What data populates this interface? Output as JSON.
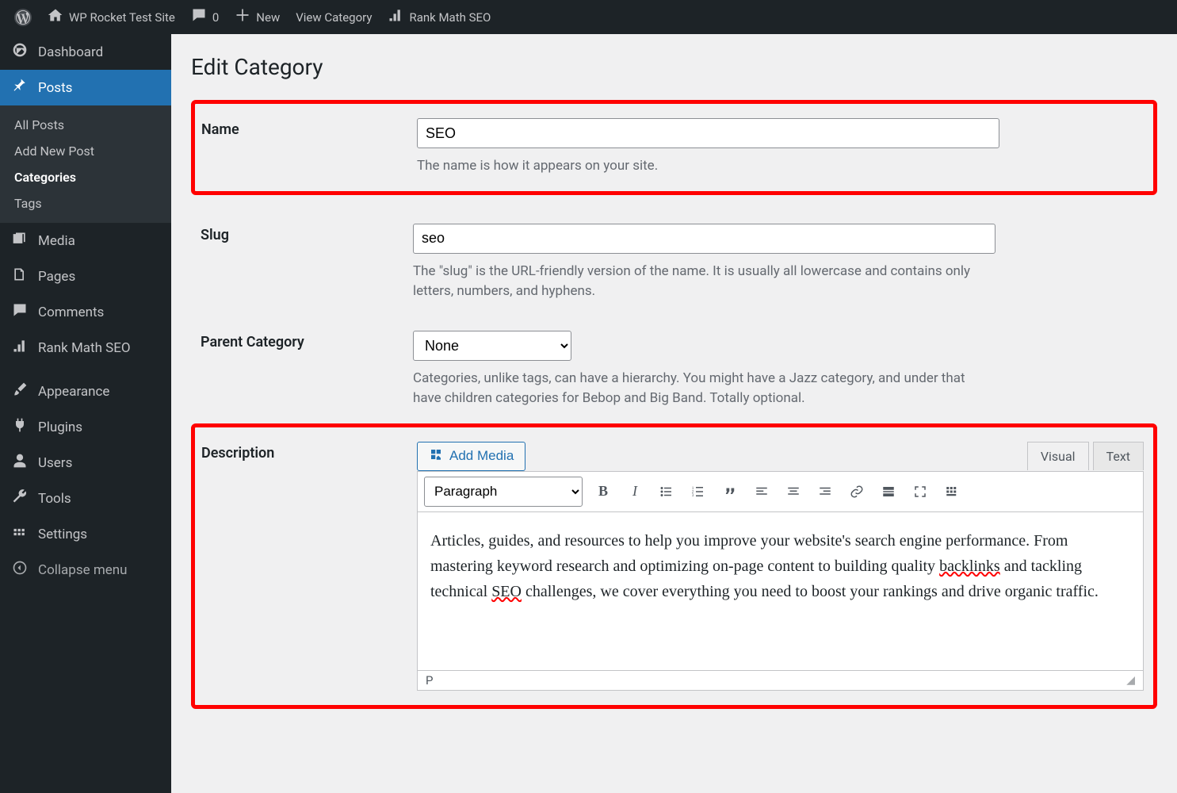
{
  "adminbar": {
    "site_title": "WP Rocket Test Site",
    "comments_count": "0",
    "new_label": "New",
    "view_label": "View Category",
    "rankmath_label": "Rank Math SEO"
  },
  "sidebar": {
    "dashboard": "Dashboard",
    "posts": "Posts",
    "posts_sub": {
      "all": "All Posts",
      "add": "Add New Post",
      "categories": "Categories",
      "tags": "Tags"
    },
    "media": "Media",
    "pages": "Pages",
    "comments": "Comments",
    "rankmath": "Rank Math SEO",
    "appearance": "Appearance",
    "plugins": "Plugins",
    "users": "Users",
    "tools": "Tools",
    "settings": "Settings",
    "collapse": "Collapse menu"
  },
  "page": {
    "title": "Edit Category",
    "name": {
      "label": "Name",
      "value": "SEO",
      "desc": "The name is how it appears on your site."
    },
    "slug": {
      "label": "Slug",
      "value": "seo",
      "desc": "The \"slug\" is the URL-friendly version of the name. It is usually all lowercase and contains only letters, numbers, and hyphens."
    },
    "parent": {
      "label": "Parent Category",
      "selected": "None",
      "desc": "Categories, unlike tags, can have a hierarchy. You might have a Jazz category, and under that have children categories for Bebop and Big Band. Totally optional."
    },
    "description": {
      "label": "Description",
      "add_media": "Add Media",
      "tabs": {
        "visual": "Visual",
        "text": "Text"
      },
      "format_selector": "Paragraph",
      "content_parts": {
        "p1": "Articles, guides, and resources to help you improve your website's search engine performance. From mastering keyword research and optimizing on-page content to building quality ",
        "spell1": "backlinks",
        "p2": " and tackling technical ",
        "spell2": "SEO",
        "p3": " challenges, we cover everything you need to boost your rankings and drive organic traffic."
      },
      "status_path": "P"
    }
  }
}
